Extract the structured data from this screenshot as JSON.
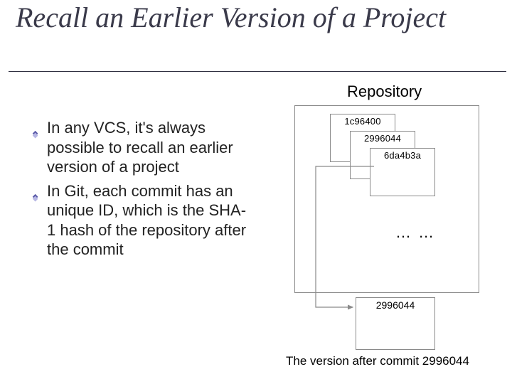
{
  "title": "Recall an Earlier Version of a Project",
  "bullets": [
    "In any VCS, it's always possible to recall an earlier version of a project",
    "In Git, each commit has an unique ID, which is the SHA-1 hash of the repository after the commit"
  ],
  "repository": {
    "label": "Repository",
    "snapshots": [
      "1c96400",
      "2996044",
      "6da4b3a"
    ],
    "ellipsis": "… …"
  },
  "recall": {
    "id": "2996044",
    "caption": "The version after commit 2996044"
  }
}
